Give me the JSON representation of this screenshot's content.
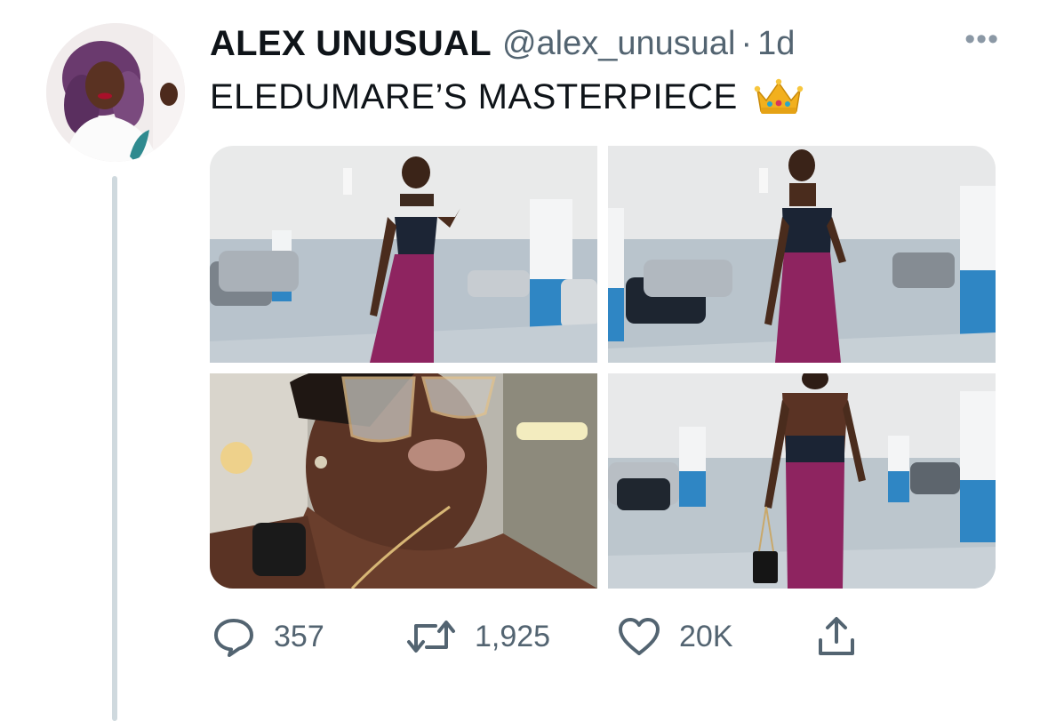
{
  "tweet": {
    "author": {
      "display_name": "ALEX UNUSUAL",
      "handle": "@alex_unusual",
      "separator": "·",
      "time": "1d",
      "avatar_icon": "profile-photo-avatar"
    },
    "text": "ELEDUMARE’S MASTERPIECE",
    "emoji": "crown-emoji",
    "more_icon": "more-options-icon",
    "media": [
      {
        "name": "photo-1",
        "description_icon": "photo"
      },
      {
        "name": "photo-2",
        "description_icon": "photo"
      },
      {
        "name": "photo-3",
        "description_icon": "photo"
      },
      {
        "name": "photo-4",
        "description_icon": "photo"
      }
    ],
    "actions": {
      "reply_count": "357",
      "retweet_count": "1,925",
      "like_count": "20K"
    }
  },
  "colors": {
    "text_primary": "#0f1419",
    "text_secondary": "#536471",
    "thread_line": "#cfd9de",
    "skirt": "#8e2460",
    "pillar_blue": "#2f86c4"
  }
}
